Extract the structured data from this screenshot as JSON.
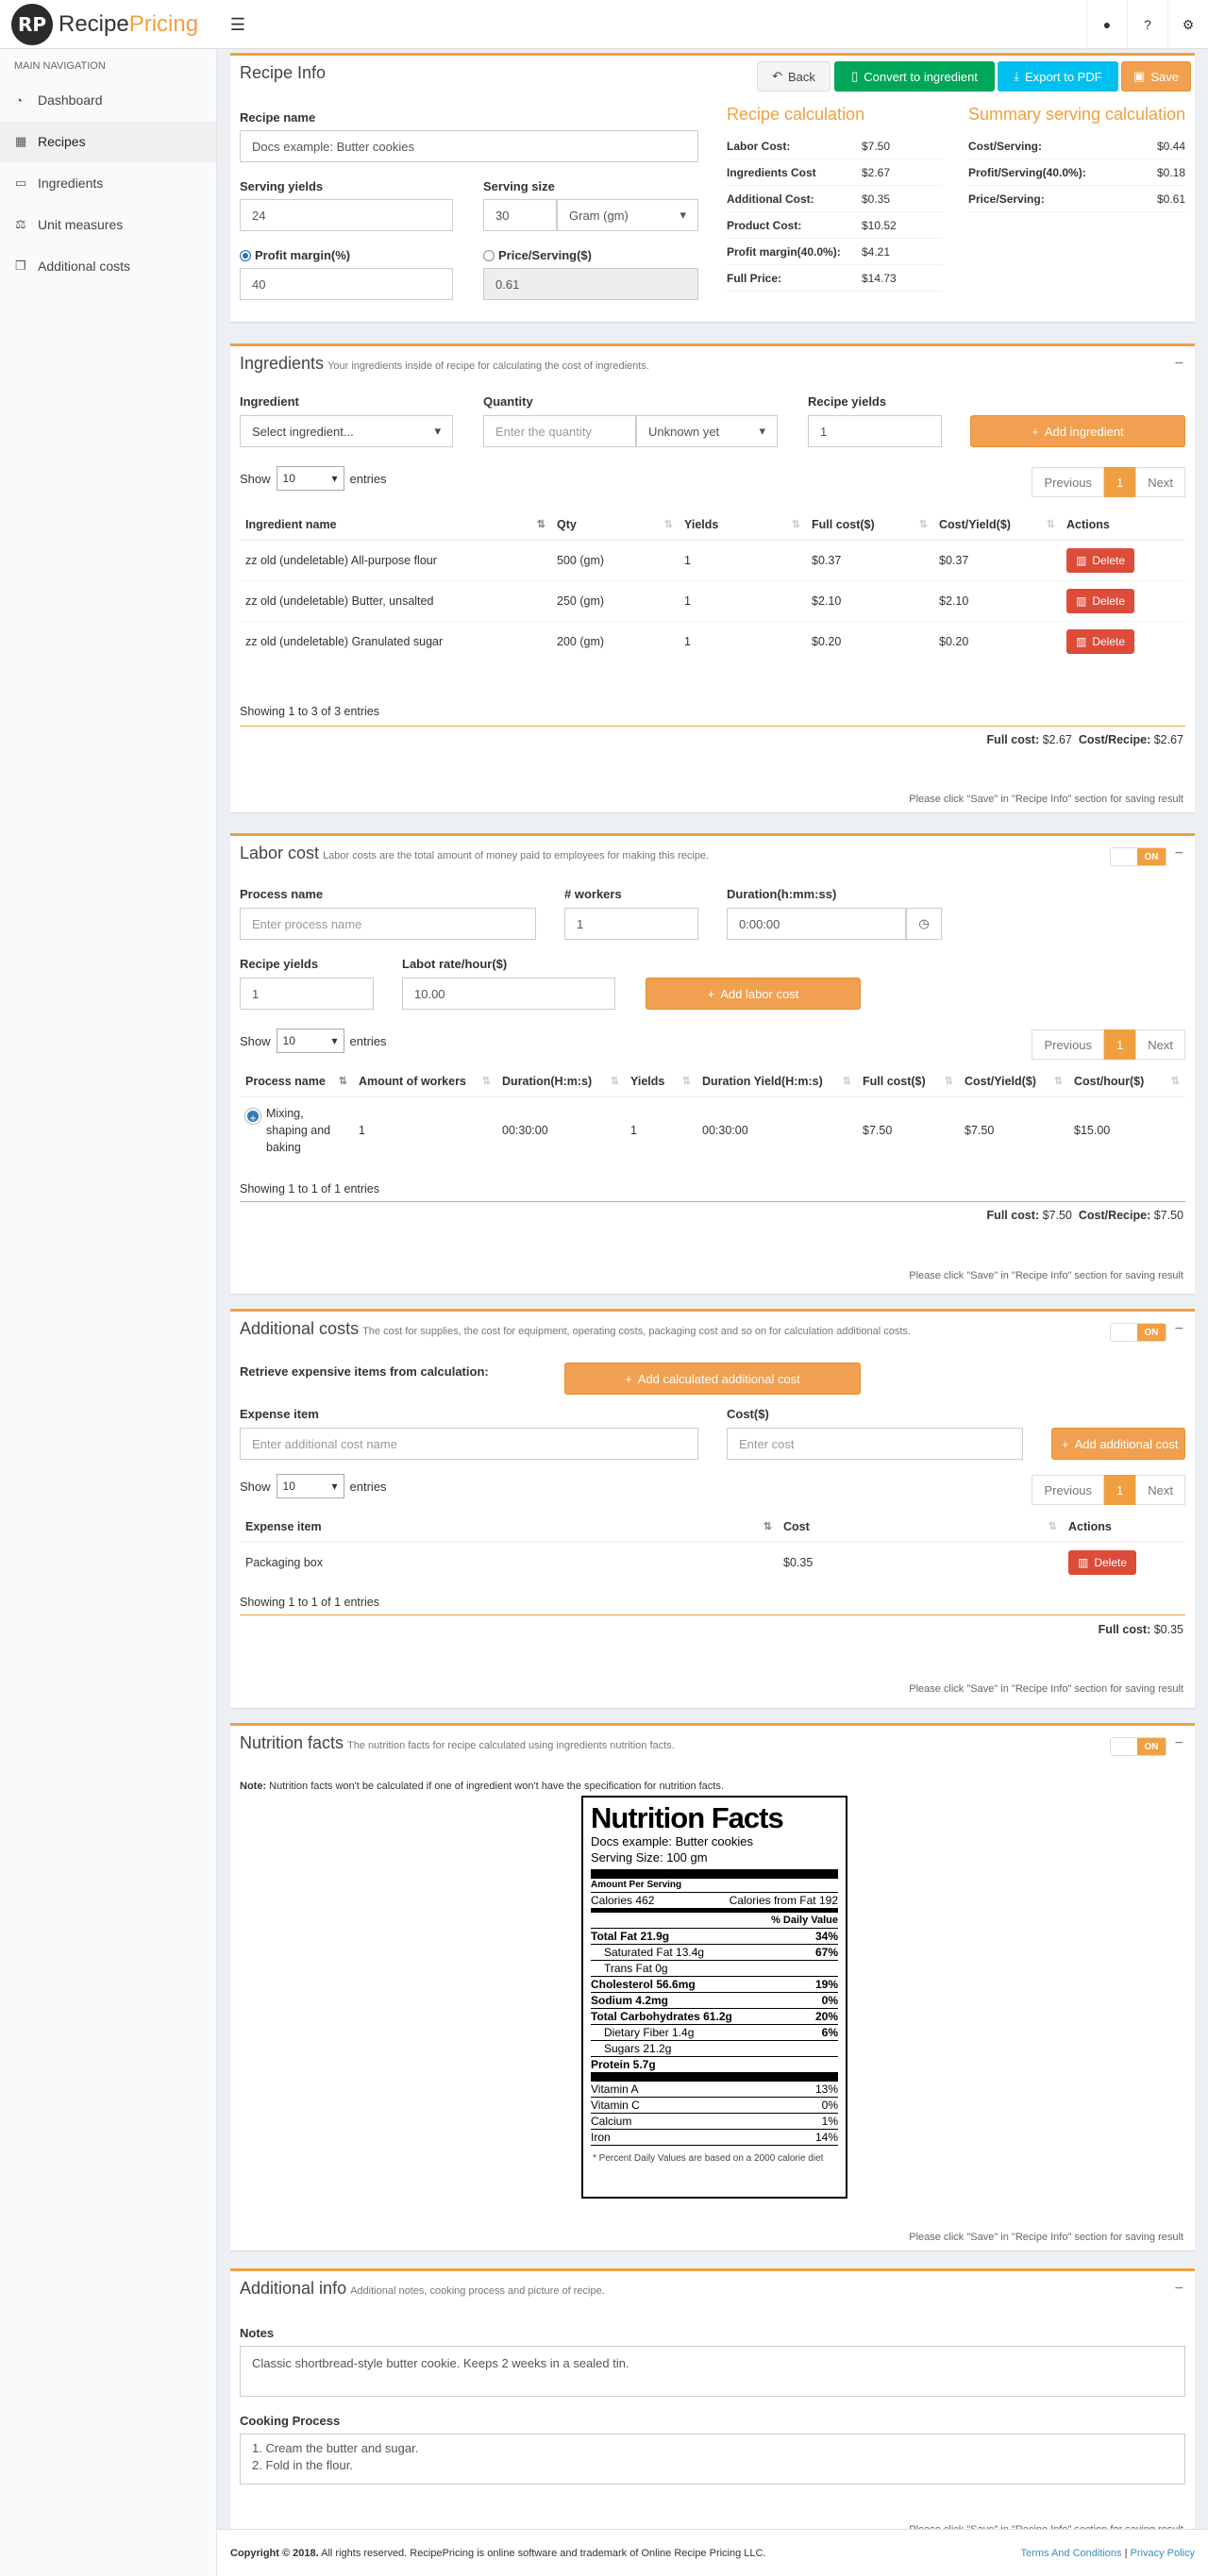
{
  "app": {
    "brand_initials": "RP",
    "brand_a": "Recipe",
    "brand_b": "Pricing"
  },
  "topbar": {
    "icons": [
      "user-icon",
      "question-icon",
      "gears-icon"
    ]
  },
  "sidebar": {
    "header": "MAIN NAVIGATION",
    "items": [
      {
        "label": "Dashboard",
        "icon": "dashboard-icon"
      },
      {
        "label": "Recipes",
        "icon": "grid-icon"
      },
      {
        "label": "Ingredients",
        "icon": "file-icon"
      },
      {
        "label": "Unit measures",
        "icon": "balance-icon"
      },
      {
        "label": "Additional costs",
        "icon": "cubes-icon"
      }
    ]
  },
  "recipe_info": {
    "title": "Recipe Info",
    "back": "Back",
    "convert": "Convert to ingredient",
    "export": "Export to PDF",
    "save": "Save",
    "name_label": "Recipe name",
    "name_value": "Docs example: Butter cookies",
    "yields_label": "Serving yields",
    "yields_value": "24",
    "size_label": "Serving size",
    "size_value": "30",
    "size_unit": "Gram (gm)",
    "margin_label": "Profit margin(%)",
    "margin_value": "40",
    "price_label": "Price/Serving($)",
    "price_value": "0.61",
    "calc_title": "Recipe calculation",
    "calc": [
      {
        "k": "Labor Cost:",
        "v": "$7.50"
      },
      {
        "k": "Ingredients Cost",
        "v": "$2.67"
      },
      {
        "k": "Additional Cost:",
        "v": "$0.35"
      },
      {
        "k": "Product Cost:",
        "v": "$10.52"
      },
      {
        "k": "Profit margin(40.0%):",
        "v": "$4.21"
      },
      {
        "k": "Full Price:",
        "v": "$14.73"
      }
    ],
    "summary_title": "Summary serving calculation",
    "summary": [
      {
        "k": "Cost/Serving:",
        "v": "$0.44"
      },
      {
        "k": "Profit/Serving(40.0%):",
        "v": "$0.18"
      },
      {
        "k": "Price/Serving:",
        "v": "$0.61"
      }
    ]
  },
  "ingredients": {
    "title": "Ingredients",
    "subtitle": "Your ingredients inside of recipe for calculating the cost of ingredients.",
    "ing_label": "Ingredient",
    "ing_ph": "Select ingredient...",
    "qty_label": "Quantity",
    "qty_ph": "Enter the quantity",
    "unit_value": "Unknown yet",
    "yields_label": "Recipe yields",
    "yields_value": "1",
    "add": "Add ingredient",
    "show": "Show",
    "entries_n": "10",
    "entries": "entries",
    "prev": "Previous",
    "page": "1",
    "next": "Next",
    "columns": [
      "Ingredient name",
      "Qty",
      "Yields",
      "Full cost($)",
      "Cost/Yield($)",
      "Actions"
    ],
    "rows": [
      [
        "zz old (undeletable) All-purpose flour",
        "500 (gm)",
        "1",
        "$0.37",
        "$0.37"
      ],
      [
        "zz old (undeletable) Butter, unsalted",
        "250 (gm)",
        "1",
        "$2.10",
        "$2.10"
      ],
      [
        "zz old (undeletable) Granulated sugar",
        "200 (gm)",
        "1",
        "$0.20",
        "$0.20"
      ]
    ],
    "delete": "Delete",
    "info": "Showing 1 to 3 of 3 entries",
    "full_cost_label": "Full cost:",
    "full_cost": "$2.67",
    "cost_recipe_label": "Cost/Recipe:",
    "cost_recipe": "$2.67",
    "note": "Please click \"Save\" in \"Recipe Info\" section for saving result"
  },
  "labor": {
    "title": "Labor cost",
    "subtitle": "Labor costs are the total amount of money paid to employees for making this recipe.",
    "toggle": "ON",
    "process_label": "Process name",
    "process_ph": "Enter process name",
    "workers_label": "# workers",
    "workers_value": "1",
    "duration_label": "Duration(h:mm:ss)",
    "duration_value": "0:00:00",
    "yields_label": "Recipe yields",
    "yields_value": "1",
    "rate_label": "Labot rate/hour($)",
    "rate_value": "10.00",
    "add": "Add labor cost",
    "show": "Show",
    "entries_n": "10",
    "entries": "entries",
    "prev": "Previous",
    "page": "1",
    "next": "Next",
    "columns": [
      "Process name",
      "Amount of workers",
      "Duration(H:m:s)",
      "Yields",
      "Duration Yield(H:m:s)",
      "Full cost($)",
      "Cost/Yield($)",
      "Cost/hour($)"
    ],
    "rows": [
      [
        "Mixing, shaping and baking",
        "1",
        "00:30:00",
        "1",
        "00:30:00",
        "$7.50",
        "$7.50",
        "$15.00"
      ]
    ],
    "info": "Showing 1 to 1 of 1 entries",
    "full_cost_label": "Full cost:",
    "full_cost": "$7.50",
    "cost_recipe_label": "Cost/Recipe:",
    "cost_recipe": "$7.50",
    "note": "Please click \"Save\" in \"Recipe Info\" section for saving result"
  },
  "additional": {
    "title": "Additional costs",
    "subtitle": "The cost for supplies, the cost for equipment, operating costs, packaging cost and so on for calculation additional costs.",
    "toggle": "ON",
    "retrieve_label": "Retrieve expensive items from calculation:",
    "add_calc": "Add calculated additional cost",
    "item_label": "Expense item",
    "item_ph": "Enter additional cost name",
    "cost_label": "Cost($)",
    "cost_ph": "Enter cost",
    "add": "Add additional cost",
    "show": "Show",
    "entries_n": "10",
    "entries": "entries",
    "prev": "Previous",
    "page": "1",
    "next": "Next",
    "columns": [
      "Expense item",
      "Cost",
      "Actions"
    ],
    "rows": [
      [
        "Packaging box",
        "$0.35"
      ]
    ],
    "delete": "Delete",
    "info": "Showing 1 to 1 of 1 entries",
    "full_cost_label": "Full cost:",
    "full_cost": "$0.35",
    "note": "Please click \"Save\" in \"Recipe Info\" section for saving result"
  },
  "nutrition": {
    "title": "Nutrition facts",
    "subtitle": "The nutrition facts for recipe calculated using ingredients nutrition facts.",
    "toggle": "ON",
    "note_b": "Note:",
    "note": "Nutrition facts won't be calculated if one of ingredient won't have the specification for nutrition facts.",
    "label_title": "Nutrition Facts",
    "label_name": "Docs example: Butter cookies",
    "serving_size": "Serving Size: 100 gm",
    "amount_per": "Amount Per Serving",
    "calories": "Calories 462",
    "calories_fat": "Calories from Fat 192",
    "dv_header": "% Daily Value",
    "rows": [
      {
        "l": "Total Fat 21.9g",
        "v": "34%",
        "b": true
      },
      {
        "l": "Saturated Fat 13.4g",
        "v": "67%",
        "i": true
      },
      {
        "l": "Trans Fat 0g",
        "v": "",
        "i": true
      },
      {
        "l": "Cholesterol 56.6mg",
        "v": "19%",
        "b": true
      },
      {
        "l": "Sodium 4.2mg",
        "v": "0%",
        "b": true
      },
      {
        "l": "Total Carbohydrates 61.2g",
        "v": "20%",
        "b": true
      },
      {
        "l": "Dietary Fiber 1.4g",
        "v": "6%",
        "i": true
      },
      {
        "l": "Sugars 21.2g",
        "v": "",
        "i": true
      },
      {
        "l": "Protein 5.7g",
        "v": "",
        "b": true
      }
    ],
    "vitamins": [
      {
        "l": "Vitamin A",
        "v": "13%"
      },
      {
        "l": "Vitamin C",
        "v": "0%"
      },
      {
        "l": "Calcium",
        "v": "1%"
      },
      {
        "l": "Iron",
        "v": "14%"
      }
    ],
    "footnote": "* Percent Daily Values are based on a 2000 calorie diet",
    "save_note": "Please click \"Save\" in \"Recipe Info\" section for saving result"
  },
  "addinfo": {
    "title": "Additional info",
    "subtitle": "Additional notes, cooking process and picture of recipe.",
    "notes_label": "Notes",
    "notes_value": "Classic shortbread-style butter cookie. Keeps 2 weeks in a sealed tin.",
    "process_label": "Cooking Process",
    "process_line1": "1. Cream the butter and sugar.",
    "process_line2": "2. Fold in the flour.",
    "note": "Please click \"Save\" in \"Recipe Info\" section for saving result"
  },
  "footer": {
    "copyright": "Copyright © 2018.",
    "rights": "All rights reserved. RecipePricing is online software and trademark of Online Recipe Pricing LLC.",
    "terms": "Terms And Conditions",
    "privacy": "Privacy Policy"
  }
}
